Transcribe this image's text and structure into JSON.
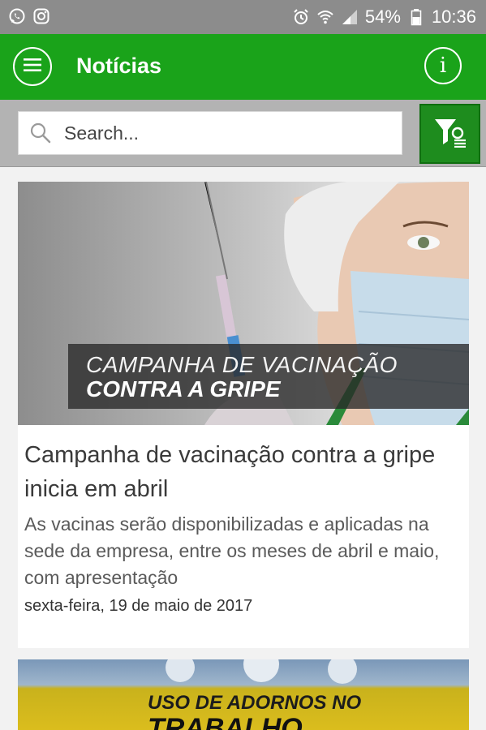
{
  "status_bar": {
    "battery": "54%",
    "time": "10:36",
    "icons_left": [
      "whatsapp-icon",
      "instagram-icon"
    ],
    "icons_right": [
      "alarm-icon",
      "wifi-icon",
      "signal-icon",
      "battery-icon"
    ]
  },
  "app_bar": {
    "title": "Notícias",
    "menu_icon": "menu-icon",
    "info_icon": "info-icon",
    "info_glyph": "i",
    "color": "#1aa31a"
  },
  "search": {
    "placeholder": "Search...",
    "value": "",
    "filter_icon": "filter-icon"
  },
  "news": [
    {
      "image_caption_line1": "CAMPANHA DE VACINAÇÃO",
      "image_caption_line2": "CONTRA A GRIPE",
      "title": "Campanha de vacinação contra a gripe inicia em abril",
      "summary": "As vacinas serão disponibilizadas e aplicadas na sede da empresa, entre os meses de abril e maio, com apresentação",
      "date": "sexta-feira, 19 de maio de 2017"
    },
    {
      "image_caption_line1": "USO DE ADORNOS NO",
      "image_caption_line2": "TRABALHO"
    }
  ]
}
